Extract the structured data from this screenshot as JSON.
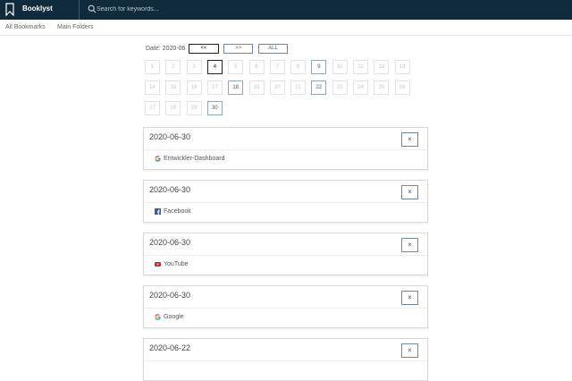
{
  "app": {
    "title": "Booklyst"
  },
  "search": {
    "placeholder": "Search for keywords..."
  },
  "nav": [
    {
      "label": "All Bookmarks"
    },
    {
      "label": "Main Folders"
    }
  ],
  "filter": {
    "date_label": "Date: 2020-06",
    "prev_label": "<<",
    "next_label": ">>",
    "all_label": "ALL",
    "days": [
      "1",
      "2",
      "3",
      "4",
      "5",
      "6",
      "7",
      "8",
      "9",
      "10",
      "11",
      "12",
      "13",
      "14",
      "15",
      "16",
      "17",
      "18",
      "19",
      "20",
      "21",
      "22",
      "23",
      "24",
      "25",
      "26",
      "27",
      "28",
      "29",
      "30"
    ],
    "active_days": [
      "4",
      "9",
      "18",
      "22",
      "30"
    ],
    "selected_day": "4"
  },
  "bookmarks": [
    {
      "date": "2020-06-30",
      "title": "Entwickler-Dashboard",
      "icon": "google-icon",
      "close": "×"
    },
    {
      "date": "2020-06-30",
      "title": "Facebook",
      "icon": "facebook-icon",
      "close": "×"
    },
    {
      "date": "2020-06-30",
      "title": "YouTube",
      "icon": "youtube-icon",
      "close": "×"
    },
    {
      "date": "2020-06-30",
      "title": "Google",
      "icon": "google-icon",
      "close": "×"
    },
    {
      "date": "2020-06-22",
      "title": "",
      "icon": "",
      "close": "×"
    }
  ],
  "colors": {
    "header_bg": "#0f2b3c",
    "accent": "#4a6c8c",
    "facebook": "#3b5998",
    "youtube": "#e62117"
  }
}
